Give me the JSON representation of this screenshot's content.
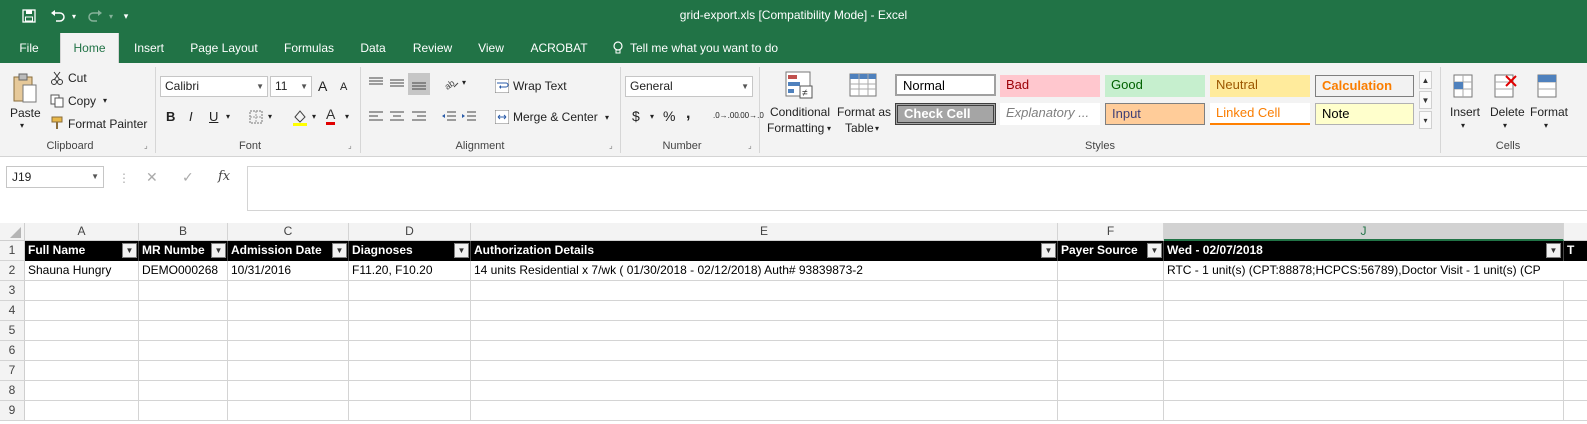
{
  "window": {
    "title": "grid-export.xls  [Compatibility Mode]  -  Excel"
  },
  "tabs": [
    {
      "label": "File"
    },
    {
      "label": "Home"
    },
    {
      "label": "Insert"
    },
    {
      "label": "Page Layout"
    },
    {
      "label": "Formulas"
    },
    {
      "label": "Data"
    },
    {
      "label": "Review"
    },
    {
      "label": "View"
    },
    {
      "label": "ACROBAT"
    },
    {
      "label": "Tell me what you want to do"
    }
  ],
  "ribbon": {
    "clipboard": {
      "paste": "Paste",
      "cut": "Cut",
      "copy": "Copy",
      "format_painter": "Format Painter",
      "label": "Clipboard"
    },
    "font": {
      "name": "Calibri",
      "size": "11",
      "label": "Font",
      "bold": "B",
      "italic": "I",
      "underline": "U",
      "grow": "A",
      "shrink": "A",
      "font_color": "A"
    },
    "alignment": {
      "wrap_text": "Wrap Text",
      "merge_center": "Merge & Center",
      "label": "Alignment"
    },
    "number": {
      "format": "General",
      "currency": "$",
      "percent": "%",
      "comma": ",",
      "inc_dec": ".0→.00",
      "dec_dec": ".00→.0",
      "label": "Number"
    },
    "styles": {
      "conditional_formatting_1": "Conditional",
      "conditional_formatting_2": "Formatting",
      "format_as_table_1": "Format as",
      "format_as_table_2": "Table",
      "gallery": {
        "normal": "Normal",
        "bad": "Bad",
        "good": "Good",
        "neutral": "Neutral",
        "calculation": "Calculation",
        "check_cell": "Check Cell",
        "explanatory": "Explanatory ...",
        "input": "Input",
        "linked_cell": "Linked Cell",
        "note": "Note"
      },
      "label": "Styles"
    },
    "cells": {
      "insert": "Insert",
      "delete": "Delete",
      "format": "Format",
      "label": "Cells"
    }
  },
  "formula_bar": {
    "name_box": "J19",
    "fx": "fx",
    "value": ""
  },
  "grid": {
    "columns": [
      "A",
      "B",
      "C",
      "D",
      "E",
      "F",
      "J"
    ],
    "rows": [
      "1",
      "2",
      "3",
      "4",
      "5",
      "6",
      "7",
      "8",
      "9"
    ],
    "header_row": [
      "Full Name",
      "MR Numbe",
      "Admission Date",
      "Diagnoses",
      "Authorization Details",
      "Payer Source",
      "Wed - 02/07/2018",
      "T"
    ],
    "data_row": [
      "Shauna Hungry",
      "DEMO000268",
      "10/31/2016",
      "F11.20, F10.20",
      "14 units Residential x 7/wk ( 01/30/2018 - 02/12/2018) Auth# 93839873-2",
      "",
      "RTC - 1 unit(s) (CPT:88878;HCPCS:56789),Doctor Visit - 1 unit(s) (CP"
    ]
  }
}
